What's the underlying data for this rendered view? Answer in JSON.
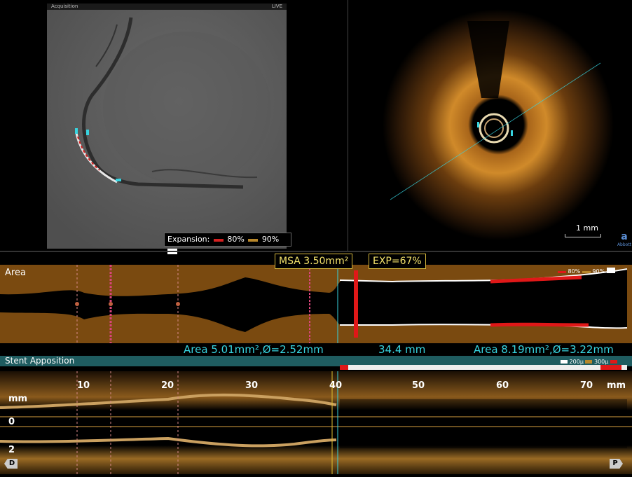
{
  "angiography": {
    "title": "Acquisition",
    "live_label": "LIVE",
    "expansion_legend": {
      "label": "Expansion:",
      "level_1": "80%",
      "level_2": "90%"
    }
  },
  "oct_view": {
    "scale_label": "1 mm",
    "logo_text": "Abbott"
  },
  "area_graph": {
    "label": "Area",
    "msa": "MSA 3.50mm²",
    "exp": "EXP=67%",
    "legend_80": "80%",
    "legend_90": "90%",
    "left_measurement": "Area 5.01mm²,Ø=2.52mm",
    "mid_measurement": "34.4 mm",
    "right_measurement": "Area 8.19mm²,Ø=3.22mm"
  },
  "stent_apposition": {
    "label": "Stent Apposition",
    "legend_200": "200µ",
    "legend_300": "300µ"
  },
  "lmode": {
    "ticks": [
      "10",
      "20",
      "30",
      "40",
      "50",
      "60",
      "70"
    ],
    "unit": "mm",
    "y_unit": "mm",
    "y_zero": "0",
    "y_two": "2",
    "distal_cap": "D",
    "proximal_cap": "P"
  },
  "colors": {
    "measure_cyan": "#37d4e0",
    "highlight_yellow": "#f3e26b",
    "area_brown": "#7a4a10",
    "malapposition_red": "#e01818"
  }
}
